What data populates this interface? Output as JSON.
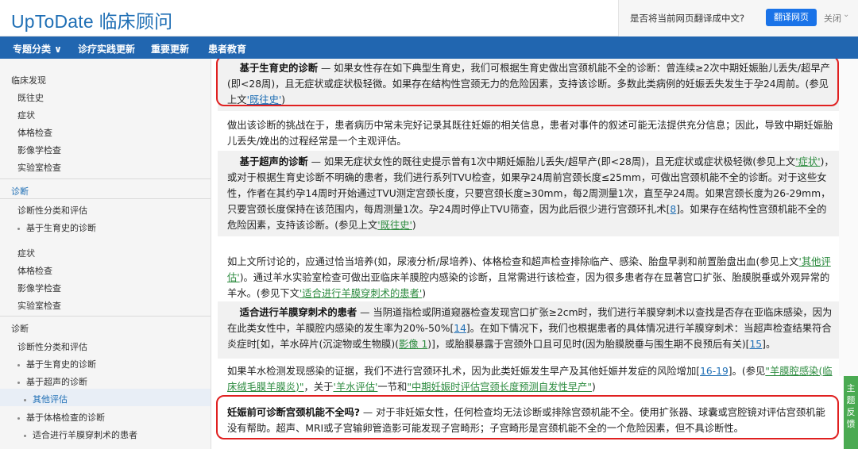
{
  "header": {
    "logo": "UpToDate 临床顾问",
    "translate_question": "是否将当前网页翻译成中文?",
    "translate_button": "翻译网页",
    "close_label": "关闭"
  },
  "nav": {
    "items": [
      "专题分类 ∨",
      "诊疗实践更新",
      "重要更新",
      "患者教育"
    ]
  },
  "sidebar": {
    "items": [
      {
        "label": "临床发现"
      },
      {
        "label": "既往史"
      },
      {
        "label": "症状"
      },
      {
        "label": "体格检查"
      },
      {
        "label": "影像学检查"
      },
      {
        "label": "实验室检查"
      },
      {
        "label": "诊断"
      },
      {
        "label": "诊断性分类和评估"
      },
      {
        "label": "基于生育史的诊断"
      },
      {
        "label": "症状"
      },
      {
        "label": "体格检查"
      },
      {
        "label": "影像学检查"
      },
      {
        "label": "实验室检查"
      },
      {
        "label": "诊断"
      },
      {
        "label": "诊断性分类和评估"
      },
      {
        "label": "基于生育史的诊断"
      },
      {
        "label": "基于超声的诊断"
      },
      {
        "label": "其他评估"
      },
      {
        "label": "基于体格检查的诊断"
      },
      {
        "label": "适合进行羊膜穿刺术的患者"
      }
    ]
  },
  "content": {
    "p1": {
      "bold": "基于生育史的诊断",
      "text": " — 如果女性存在如下典型生育史，我们可根据生育史做出宫颈机能不全的诊断：曾连续≥2次中期妊娠胎儿丢失/超早产(即<28周)，且无症状或症状极轻微。如果存在结构性宫颈无力的危险因素，支持该诊断。多数此类病例的妊娠丢失发生于孕24周前。(参见上文",
      "link": "'既往史'",
      "end": ")"
    },
    "p2": {
      "text": "做出该诊断的挑战在于，患者病历中常未完好记录其既往妊娠的相关信息，患者对事件的叙述可能无法提供充分信息；因此，导致中期妊娠胎儿丢失/娩出的过程经常是一个主观评估。"
    },
    "p3": {
      "bold": "基于超声的诊断",
      "text": " — 如果无症状女性的既往史提示曾有1次中期妊娠胎儿丢失/超早产(即<28周)，且无症状或症状极轻微(参见上文",
      "link1": "'症状'",
      "text2": ")，或对于根据生育史诊断不明确的患者，我们进行系列TVU检查，如果孕24周前宫颈长度≤25mm，可做出宫颈机能不全的诊断。对于这些女性，作者在其约孕14周时开始通过TVU测定宫颈长度，只要宫颈长度≥30mm，每2周测量1次，直至孕24周。如果宫颈长度为26-29mm，只要宫颈长度保持在该范围内，每周测量1次。孕24周时停止TVU筛查，因为此后很少进行宫颈环扎术[",
      "ref": "8",
      "text3": "]。如果存在结构性宫颈机能不全的危险因素，支持该诊断。(参见上文",
      "link2": "'既往史'",
      "end": ")"
    },
    "p4": {
      "text": "如上文所讨论的，应通过恰当培养(如，尿液分析/尿培养)、体格检查和超声检查排除临产、感染、胎盘早剥和前置胎盘出血(参见上文",
      "link1": "'其他评估'",
      "text2": ")。通过羊水实验室检查可做出亚临床羊膜腔内感染的诊断，且常需进行该检查，因为很多患者存在显著宫口扩张、胎膜脱垂或外观异常的羊水。(参见下文",
      "link2": "'适合进行羊膜穿刺术的患者'",
      "end": ")"
    },
    "p5": {
      "bold": "适合进行羊膜穿刺术的患者",
      "text": " — 当阴道指检或阴道窥器检查发现宫口扩张≥2cm时，我们进行羊膜穿刺术以查找是否存在亚临床感染，因为在此类女性中，羊膜腔内感染的发生率为20%-50%[",
      "ref1": "14",
      "text2": "]。在如下情况下，我们也根据患者的具体情况进行羊膜穿刺术：当超声检查结果符合炎症时[如，羊水碎片(沉淀物或生物膜)(",
      "link1": "影像 1",
      "text3": ")]，或胎膜暴露于宫颈外口且可见时(因为胎膜脱垂与围生期不良预后有关)[",
      "ref2": "15",
      "end": "]。"
    },
    "p6": {
      "text": "如果羊水检测发现感染的证据，我们不进行宫颈环扎术，因为此类妊娠发生早产及其他妊娠并发症的风险增加[",
      "ref": "16-19",
      "text2": "]。(参见",
      "link1": "\"羊膜腔感染(临床绒毛膜羊膜炎)\"",
      "text3": "，关于",
      "link2": "'羊水评估'",
      "text4": "一节",
      "text5": "和",
      "link3": "\"中期妊娠时评估宫颈长度预测自发性早产\"",
      "end": ")"
    },
    "p7": {
      "bold": "妊娠前可诊断宫颈机能不全吗?",
      "text": " — 对于非妊娠女性，任何检查均无法诊断或排除宫颈机能不全。使用扩张器、球囊或宫腔镜对评估宫颈机能没有帮助。超声、MRI或子宫输卵管造影可能发现子宫畸形；子宫畸形是宫颈机能不全的一个危险因素，但不具诊断性。"
    }
  },
  "feedback": {
    "label": "主题反馈"
  },
  "colors": {
    "brand_blue": "#2166b0",
    "link_blue": "#1f6fb5",
    "highlight_red": "#e02020",
    "feedback_green": "#4aaa52"
  }
}
